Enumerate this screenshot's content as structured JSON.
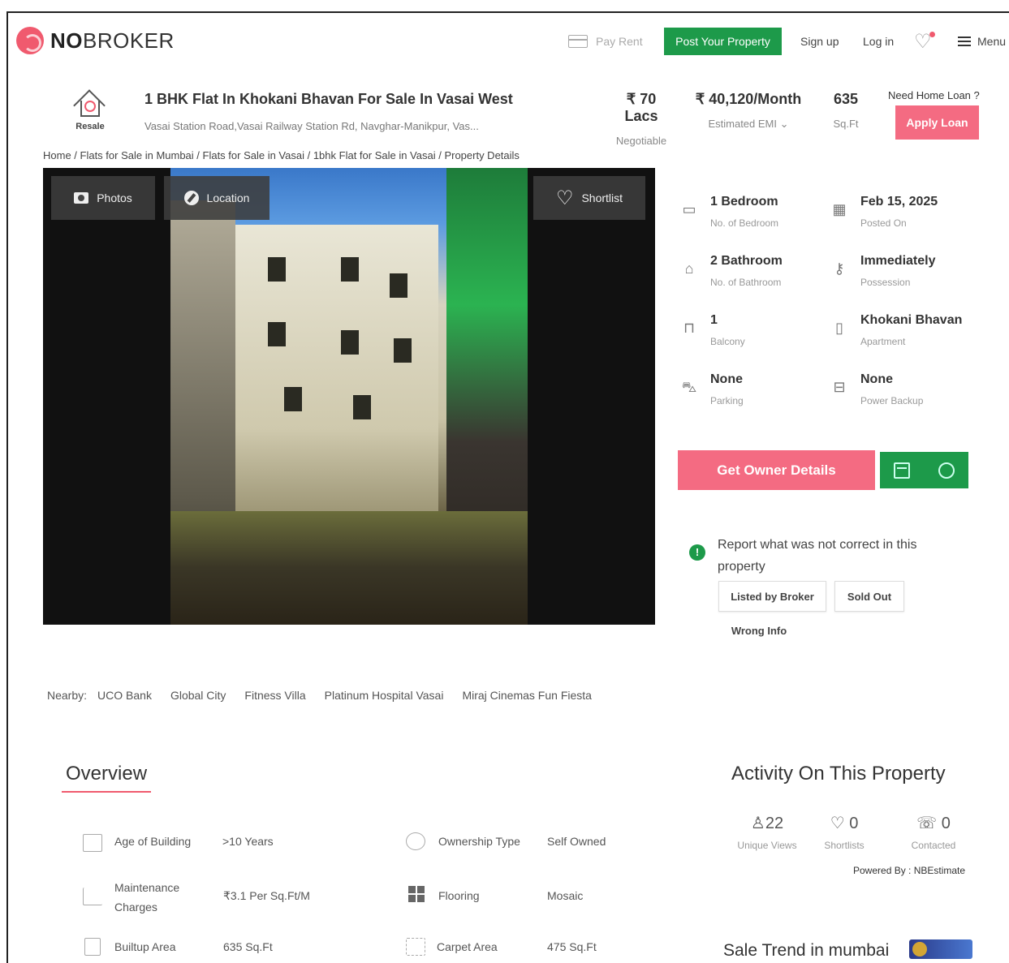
{
  "header": {
    "logo_bold": "NO",
    "logo_rest": "BROKER",
    "pay_rent": "Pay Rent",
    "post_property": "Post Your Property",
    "sign_up": "Sign up",
    "log_in": "Log in",
    "menu": "Menu"
  },
  "listing": {
    "resale_label": "Resale",
    "title": "1 BHK Flat In Khokani Bhavan For Sale In Vasai West",
    "address": "Vasai Station Road,Vasai Railway Station Rd, Navghar-Manikpur, Vas...",
    "price": "₹ 70 Lacs",
    "price_note": "Negotiable",
    "emi": "₹ 40,120/Month",
    "emi_note": "Estimated EMI",
    "area": "635",
    "area_unit": "Sq.Ft",
    "loan_question": "Need Home Loan ?",
    "apply_loan": "Apply Loan"
  },
  "breadcrumb": "Home / Flats for Sale in Mumbai / Flats for Sale in Vasai / 1bhk Flat for Sale in Vasai / Property Details",
  "gallery": {
    "photos": "Photos",
    "location": "Location",
    "shortlist": "Shortlist"
  },
  "specs": [
    {
      "value": "1 Bedroom",
      "label": "No. of Bedroom",
      "icon": "bed-icon"
    },
    {
      "value": "Feb 15, 2025",
      "label": "Posted On",
      "icon": "calendar-icon"
    },
    {
      "value": "2 Bathroom",
      "label": "No. of Bathroom",
      "icon": "bathtub-icon"
    },
    {
      "value": "Immediately",
      "label": "Possession",
      "icon": "key-icon"
    },
    {
      "value": "1",
      "label": "Balcony",
      "icon": "balcony-icon"
    },
    {
      "value": "Khokani Bhavan",
      "label": "Apartment",
      "icon": "building-icon"
    },
    {
      "value": "None",
      "label": "Parking",
      "icon": "car-icon"
    },
    {
      "value": "None",
      "label": "Power Backup",
      "icon": "battery-icon"
    }
  ],
  "actions": {
    "get_owner": "Get Owner Details"
  },
  "report": {
    "text": "Report what was not correct in this property",
    "options": [
      "Listed by Broker",
      "Sold Out",
      "Wrong Info"
    ]
  },
  "nearby": {
    "label": "Nearby:",
    "places": [
      "UCO Bank",
      "Global City",
      "Fitness Villa",
      "Platinum Hospital Vasai",
      "Miraj Cinemas Fun Fiesta"
    ]
  },
  "overview": {
    "title": "Overview",
    "rows": [
      {
        "label": "Age of Building",
        "value": ">10 Years"
      },
      {
        "label": "Ownership Type",
        "value": "Self Owned"
      },
      {
        "label": "Maintenance Charges",
        "value": "₹3.1 Per Sq.Ft/M"
      },
      {
        "label": "Flooring",
        "value": "Mosaic"
      },
      {
        "label": "Builtup Area",
        "value": "635 Sq.Ft"
      },
      {
        "label": "Carpet Area",
        "value": "475 Sq.Ft"
      }
    ]
  },
  "activity": {
    "title": "Activity On This Property",
    "unique_views": "22",
    "unique_views_label": "Unique Views",
    "shortlists": "0",
    "shortlists_label": "Shortlists",
    "contacted": "0",
    "contacted_label": "Contacted",
    "powered_by": "Powered By : NBEstimate"
  },
  "sale_trend": "Sale Trend in mumbai",
  "colors": {
    "brand_pink": "#f46b82",
    "brand_green": "#1d9a4a"
  }
}
